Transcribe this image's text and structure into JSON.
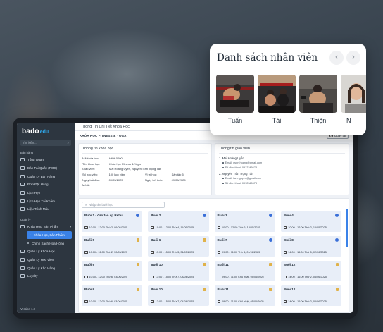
{
  "sidebar": {
    "logo_main": "bado",
    "logo_edu": "edu",
    "search_placeholder": "Tìm kiếm...",
    "group_sales": "Bán hàng",
    "sales_items": [
      "Tổng Quan",
      "Bán Tại Quầy (POS)",
      "Quản Lý Bán Hàng",
      "Đơn Đặt Hàng",
      "Lịch Hẹn",
      "Lịch Hẹn Tái Khám",
      "Liệu Trình Mẫu"
    ],
    "group_manage": "Quản lý",
    "manage_parent": "Khóa Học, Sản Phẩm",
    "manage_active": "Khóa Học, Sản Phẩm",
    "manage_sub": "Chính Sách Hoa Hồng",
    "manage_items": [
      "Quản Lý Khóa Học",
      "Quản Lý Học Viên",
      "Quản Lý Kho Hàng",
      "Loyalty"
    ],
    "version": "Version 1.0"
  },
  "main": {
    "topbar_title": "Thông Tin Chi Tiết Khóa Học",
    "breadcrumb": "KHÓA HỌC FITNESS & YOGA",
    "back_label": "Quay lại",
    "course_info": {
      "title": "Thông tin khóa học",
      "rows": [
        {
          "k1": "Mã khóa học:",
          "v1": "HKH-00001",
          "k2": "",
          "v2": ""
        },
        {
          "k1": "Tên khóa học:",
          "v1": "Khóa học Fitness & Yoga",
          "k2": "",
          "v2": ""
        },
        {
          "k1": "Giáo viên:",
          "v1": "Mai Hoàng Uyên, Nguyễn Trần Trọng Tấn",
          "k2": "",
          "v2": ""
        },
        {
          "k1": "Số học viên:",
          "v1": "100 học viên",
          "k2": "Vị trí học:",
          "v2": "Sân tập 5"
        },
        {
          "k1": "Ngày bắt đầu:",
          "v1": "09/05/2025",
          "k2": "Ngày kết thúc:",
          "v2": "09/05/2025"
        },
        {
          "k1": "Mô tả:",
          "v1": "",
          "k2": "",
          "v2": ""
        }
      ]
    },
    "teacher_info": {
      "title": "Thông tin giáo viên",
      "teachers": [
        {
          "name": "1. Mai Hoàng Uyên",
          "email": "Email: uyen.hoang@gmail.com",
          "phone": "Số điện thoại: 0912345678"
        },
        {
          "name": "2. Nguyễn Trần Trọng Tấn",
          "email": "Email: tan.nguyen@gmail.com",
          "phone": "Số điện thoại: 0912345678"
        }
      ]
    },
    "lesson_search_placeholder": "Nhập tên buổi học",
    "lessons": [
      {
        "name": "Buổi 1 - đào tạo sp Retail",
        "time": "10:00 - 12:00 Thứ 2, 09/05/2025",
        "icon": "clock-icon"
      },
      {
        "name": "Buổi 2",
        "time": "10:00 - 12:00 Thứ 4, 11/05/2025",
        "icon": "clock-icon"
      },
      {
        "name": "Buổi 3",
        "time": "10:00 - 12:00 Thứ 6, 13/05/2025",
        "icon": "clock-icon"
      },
      {
        "name": "Buổi 4",
        "time": "10:00 - 12:00 Thứ 2, 16/05/2025",
        "icon": "clock-icon"
      },
      {
        "name": "Buổi 5",
        "time": "10:00 - 12:00 Thứ 2, 30/05/2025",
        "icon": "doc-icon"
      },
      {
        "name": "Buổi 6",
        "time": "13:00 - 15:00 Thứ 3, 31/05/2025",
        "icon": "doc-icon"
      },
      {
        "name": "Buổi 7",
        "time": "09:00 - 11:00 Thứ 4, 01/06/2025",
        "icon": "clock-icon"
      },
      {
        "name": "Buổi 8",
        "time": "14:00 - 16:00 Thứ 5, 02/06/2025",
        "icon": "clock-icon"
      },
      {
        "name": "Buổi 9",
        "time": "10:00 - 12:00 Thứ 6, 03/06/2025",
        "icon": "doc-icon"
      },
      {
        "name": "Buổi 10",
        "time": "13:00 - 15:00 Thứ 7, 04/06/2025",
        "icon": "doc-icon"
      },
      {
        "name": "Buổi 11",
        "time": "09:00 - 11:00 Chủ nhật, 05/06/2025",
        "icon": "doc-icon"
      },
      {
        "name": "Buổi 12",
        "time": "14:00 - 16:00 Thứ 2, 06/06/2025",
        "icon": "doc-icon"
      },
      {
        "name": "Buổi 9",
        "time": "10:00 - 12:00 Thứ 6, 03/06/2025",
        "icon": "doc-icon"
      },
      {
        "name": "Buổi 10",
        "time": "13:00 - 15:00 Thứ 7, 04/06/2025",
        "icon": "doc-icon"
      },
      {
        "name": "Buổi 11",
        "time": "09:00 - 11:00 Chủ nhật, 05/06/2025",
        "icon": "doc-icon"
      },
      {
        "name": "Buổi 12",
        "time": "14:00 - 16:00 Thứ 2, 06/06/2025",
        "icon": "doc-icon"
      }
    ]
  },
  "staff": {
    "title": "Danh sách nhân viên",
    "prev_icon": "chevron-left-icon",
    "next_icon": "chevron-right-icon",
    "people": [
      {
        "name": "Tuấn"
      },
      {
        "name": "Tài"
      },
      {
        "name": "Thiện"
      },
      {
        "name": "N"
      }
    ]
  }
}
